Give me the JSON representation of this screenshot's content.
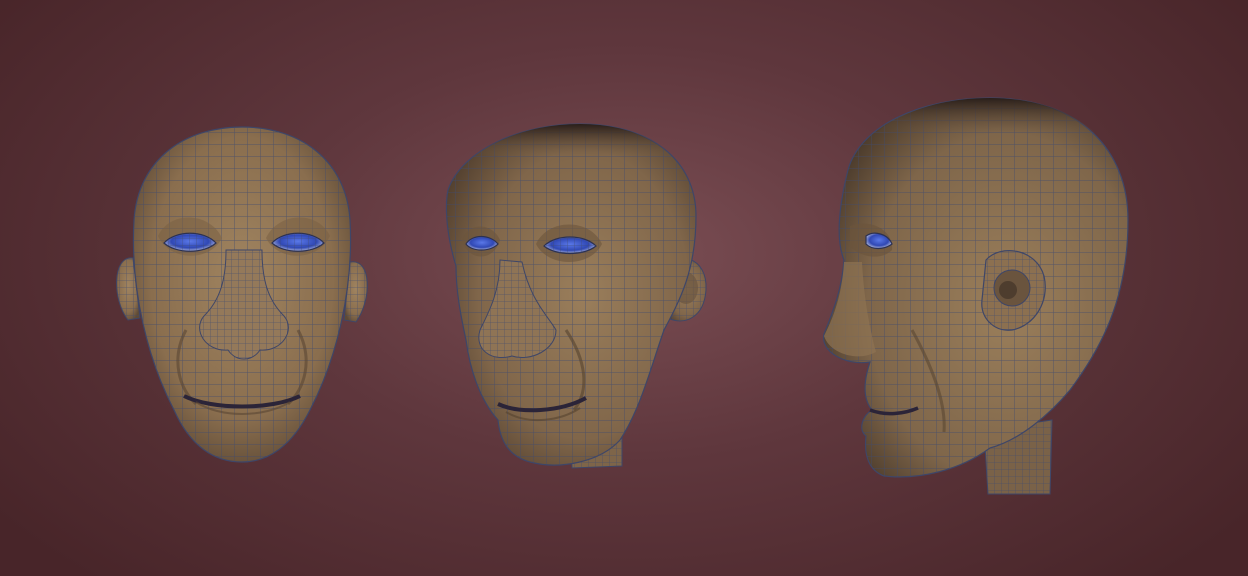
{
  "scene": {
    "background_colors": [
      "#7b4e54",
      "#5f373d",
      "#482529"
    ],
    "skin_color": "#8c7150",
    "wire_color": "#404a6e",
    "eye_color": "#3a52c0"
  },
  "models": [
    {
      "name": "head-front-view"
    },
    {
      "name": "head-three-quarter-view"
    },
    {
      "name": "head-side-view"
    }
  ]
}
